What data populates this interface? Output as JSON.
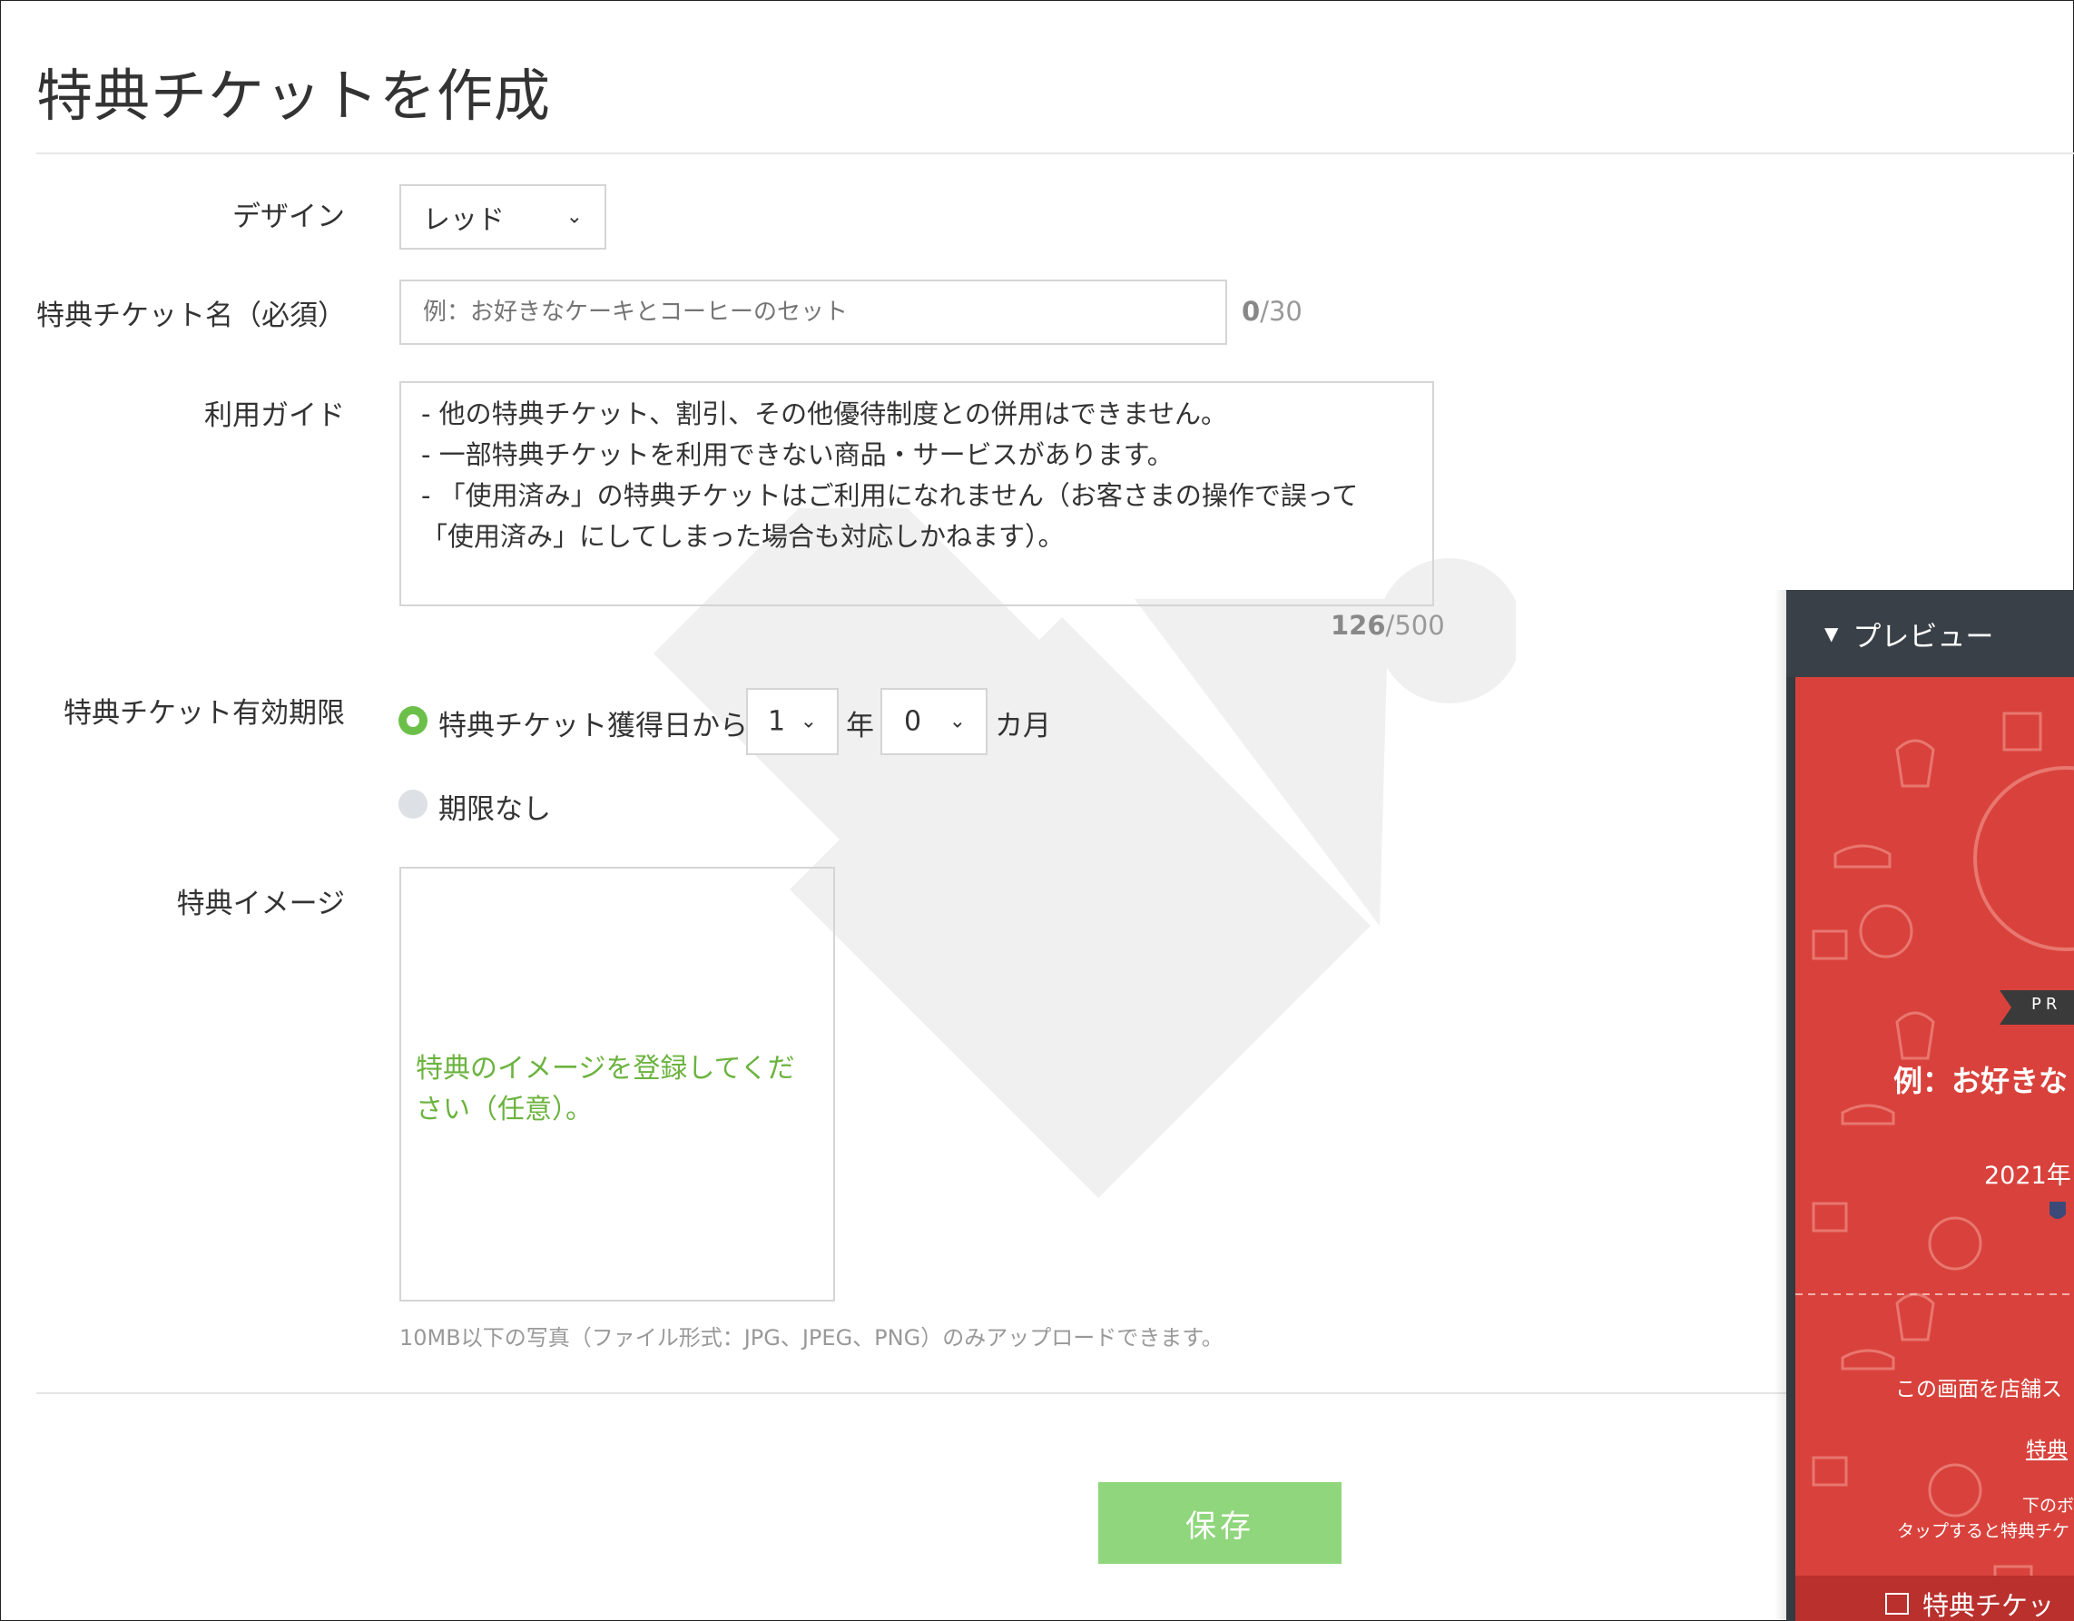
{
  "page": {
    "title": "特典チケットを作成"
  },
  "form": {
    "design": {
      "label": "デザイン",
      "value": "レッド"
    },
    "ticket_name": {
      "label": "特典チケット名（必須）",
      "placeholder": "例：お好きなケーキとコーヒーのセット",
      "count": "0",
      "max": "/30"
    },
    "usage_guide": {
      "label": "利用ガイド",
      "text": "- 他の特典チケット、割引、その他優待制度との併用はできません。\n- 一部特典チケットを利用できない商品・サービスがあります。\n- 「使用済み」の特典チケットはご利用になれません（お客さまの操作で誤って\n「使用済み」にしてしまった場合も対応しかねます）。",
      "count": "126",
      "max": "/500"
    },
    "validity": {
      "label": "特典チケット有効期限",
      "option_from_acquired": "特典チケット獲得日から",
      "years_value": "1",
      "years_unit": "年",
      "months_value": "0",
      "months_unit": "カ月",
      "option_no_limit": "期限なし",
      "selected": "option_from_acquired"
    },
    "image": {
      "label": "特典イメージ",
      "upload_message": "特典のイメージを登録してください（任意）。",
      "note": "10MB以下の写真（ファイル形式：JPG、JPEG、PNG）のみアップロードできます。"
    },
    "save_label": "保存"
  },
  "preview": {
    "title": "プレビュー",
    "badge": "PR",
    "name_text": "例：お好きな",
    "date_text": "2021年",
    "instruction": "この画面を店舗ス",
    "link_text": "特典",
    "small_line1": "下のボ",
    "small_line2": "タップすると特典チケ",
    "bottom_bar": "特典チケッ"
  },
  "colors": {
    "accent_green": "#6cc04a",
    "save_button": "#8fd67c",
    "preview_red": "#d9423c",
    "preview_header": "#3a4047"
  }
}
